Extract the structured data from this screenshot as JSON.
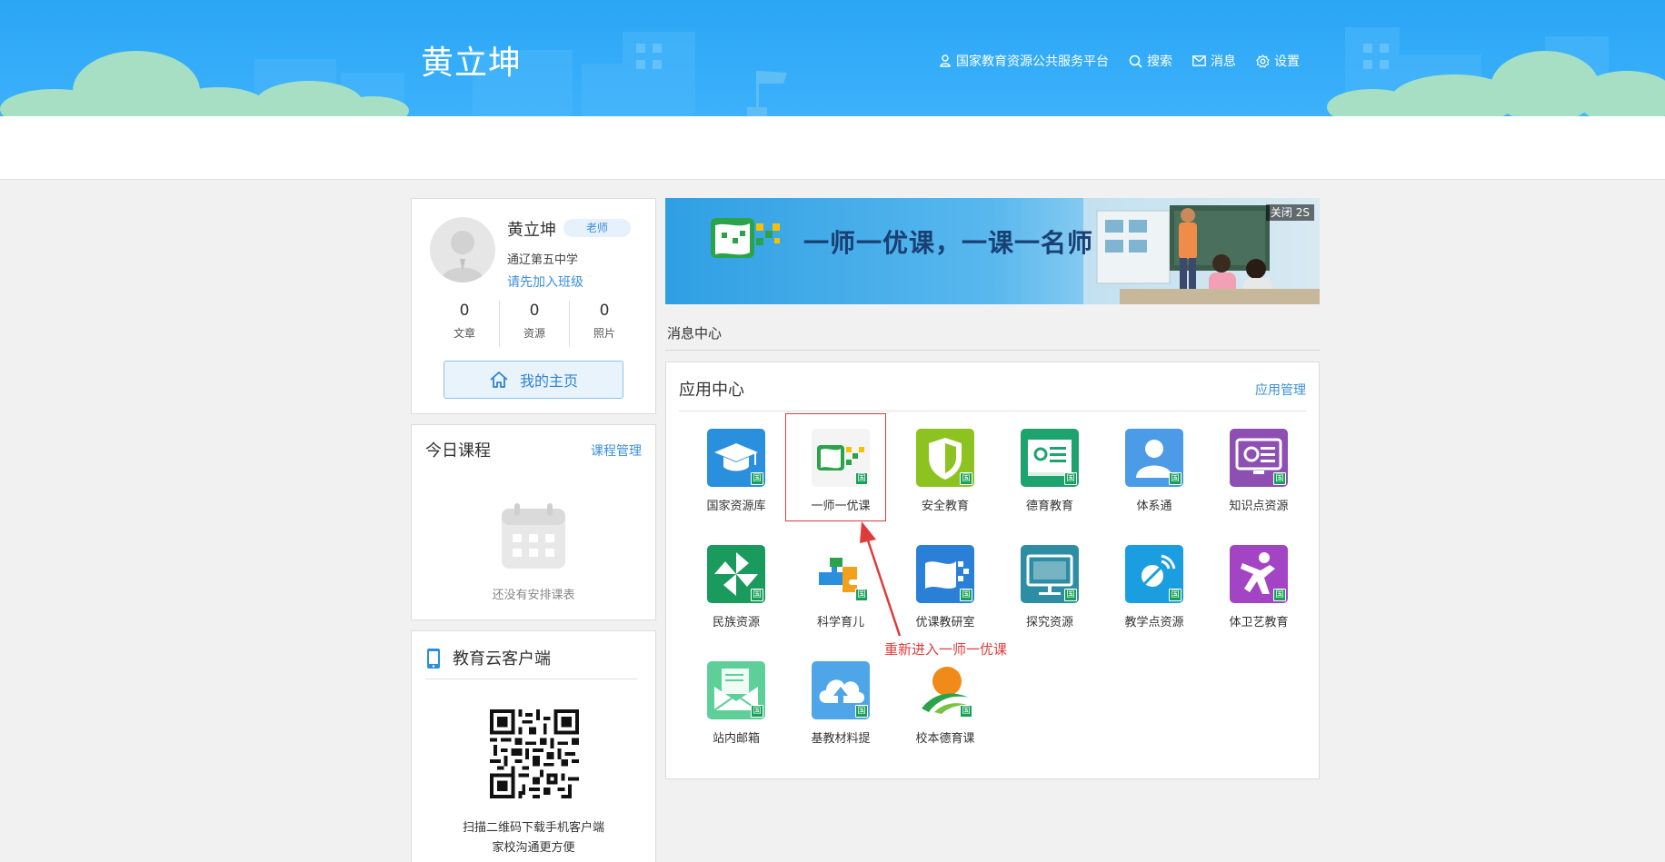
{
  "header": {
    "title": "黄立坤",
    "nav": [
      {
        "label": "国家教育资源公共服务平台",
        "icon": "user-icon"
      },
      {
        "label": "搜索",
        "icon": "search-icon"
      },
      {
        "label": "消息",
        "icon": "mail-icon"
      },
      {
        "label": "设置",
        "icon": "gear-icon"
      }
    ]
  },
  "profile": {
    "name": "黄立坤",
    "role_badge": "老师",
    "school": "通辽第五中学",
    "join_link": "请先加入班级",
    "stats": [
      {
        "value": "0",
        "label": "文章"
      },
      {
        "value": "0",
        "label": "资源"
      },
      {
        "value": "0",
        "label": "照片"
      }
    ],
    "home_button": "我的主页"
  },
  "courses": {
    "title": "今日课程",
    "manage_link": "课程管理",
    "empty_text": "还没有安排课表"
  },
  "client": {
    "title": "教育云客户端",
    "qr_text_line1": "扫描二维码下载手机客户端",
    "qr_text_line2": "家校沟通更方便"
  },
  "banner": {
    "slogan": "一师一优课，一课一名师",
    "close_label": "关闭 2S"
  },
  "message_center": {
    "title": "消息中心"
  },
  "app_center": {
    "title": "应用中心",
    "manage_link": "应用管理",
    "badge_char": "国",
    "apps": [
      {
        "label": "国家资源库",
        "icon": "graduation-cap-icon",
        "color": "#2a8fdc"
      },
      {
        "label": "一师一优课",
        "icon": "yishi-youke-logo-icon",
        "color": "#f4f4f4"
      },
      {
        "label": "安全教育",
        "icon": "shield-icon",
        "color": "#8cc320"
      },
      {
        "label": "德育教育",
        "icon": "microscope-board-icon",
        "color": "#1fa36e"
      },
      {
        "label": "体系通",
        "icon": "person-icon",
        "color": "#4b9be6"
      },
      {
        "label": "知识点资源",
        "icon": "monitor-chart-icon",
        "color": "#8e4fb3"
      },
      {
        "label": "民族资源",
        "icon": "pinwheel-icon",
        "color": "#1b9a5d"
      },
      {
        "label": "科学育儿",
        "icon": "puzzle-icon",
        "color": "#ffffff"
      },
      {
        "label": "优课教研室",
        "icon": "youke-logo-icon",
        "color": "#2a7fd6"
      },
      {
        "label": "探究资源",
        "icon": "screen-icon",
        "color": "#2d8da3"
      },
      {
        "label": "教学点资源",
        "icon": "satellite-icon",
        "color": "#1a9ee0"
      },
      {
        "label": "体卫艺教育",
        "icon": "figure-icon",
        "color": "#a344c4"
      },
      {
        "label": "站内邮箱",
        "icon": "envelope-icon",
        "color": "#5fcf9a"
      },
      {
        "label": "基教材料提",
        "icon": "cloud-upload-icon",
        "color": "#4ea5e8"
      },
      {
        "label": "校本德育课",
        "icon": "sun-leaf-icon",
        "color": "#ffffff"
      }
    ]
  },
  "annotation": {
    "text": "重新进入一师一优课",
    "color": "#e03b3b"
  }
}
